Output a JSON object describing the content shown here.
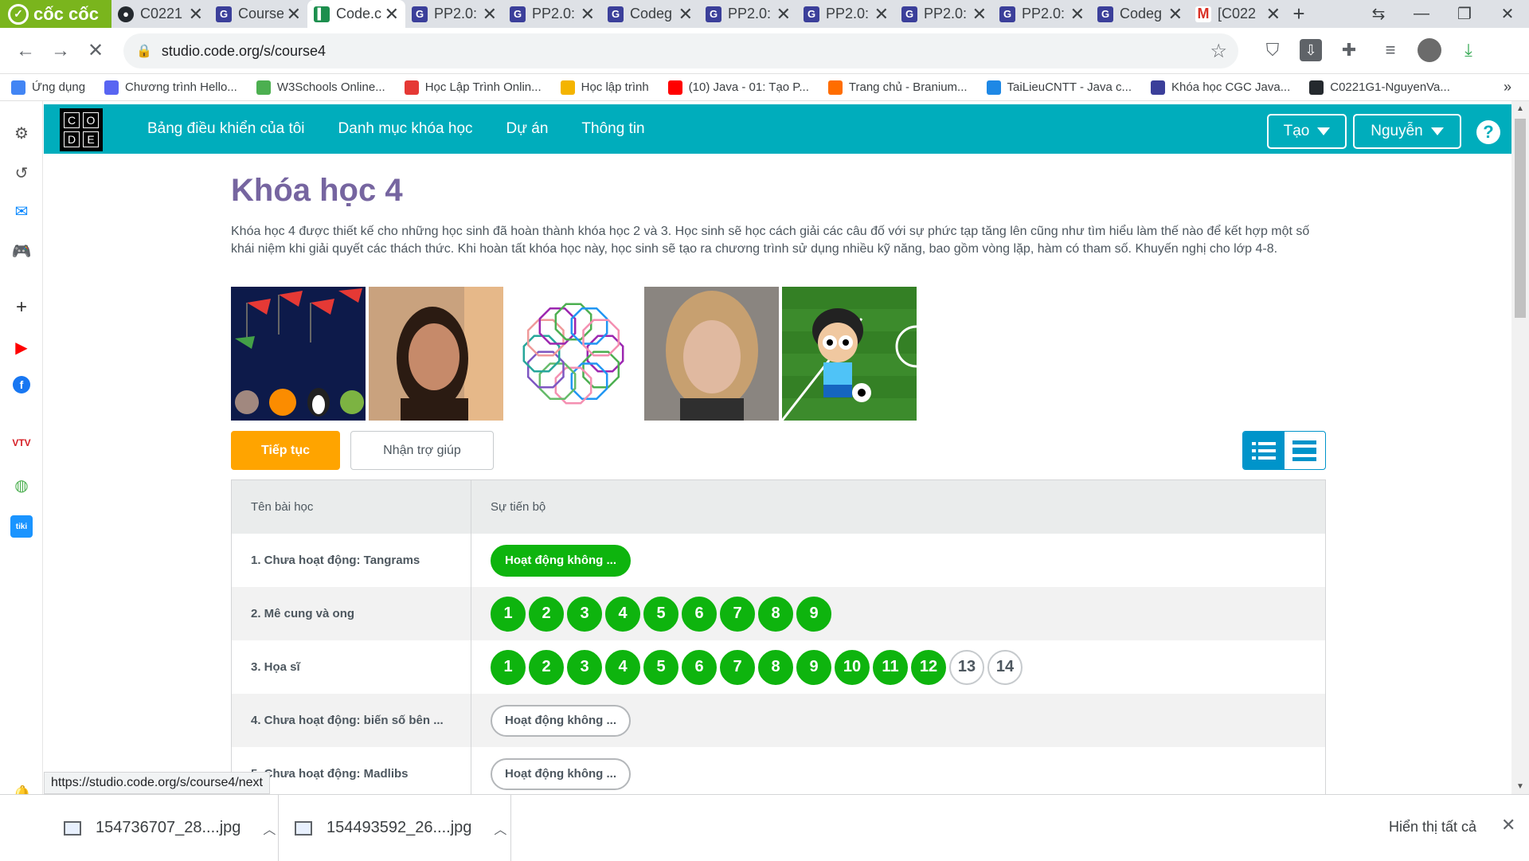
{
  "browser": {
    "brand": "cốc cốc",
    "tabs": [
      {
        "title": "C0221",
        "icon": "github-icon"
      },
      {
        "title": "Course",
        "icon": "codegym-icon"
      },
      {
        "title": "Code.c",
        "icon": "code-org-icon",
        "active": true
      },
      {
        "title": "PP2.0:",
        "icon": "codegym-icon"
      },
      {
        "title": "PP2.0:",
        "icon": "codegym-icon"
      },
      {
        "title": "Codeg",
        "icon": "codegym-icon"
      },
      {
        "title": "PP2.0:",
        "icon": "codegym-icon"
      },
      {
        "title": "PP2.0:",
        "icon": "codegym-icon"
      },
      {
        "title": "PP2.0:",
        "icon": "codegym-icon"
      },
      {
        "title": "PP2.0:",
        "icon": "codegym-icon"
      },
      {
        "title": "Codeg",
        "icon": "codegym-icon"
      },
      {
        "title": "[C022",
        "icon": "gmail-icon"
      }
    ],
    "url": "studio.code.org/s/course4",
    "bookmarks": [
      {
        "label": "Ứng dụng",
        "color": "#4285f4"
      },
      {
        "label": "Chương trình Hello...",
        "color": "#5865f2"
      },
      {
        "label": "W3Schools Online...",
        "color": "#4caf50"
      },
      {
        "label": "Học Lập Trình Onlin...",
        "color": "#e53935"
      },
      {
        "label": "Học lập trình",
        "color": "#f4b400"
      },
      {
        "label": "(10) Java - 01: Tạo P...",
        "color": "#ff0000"
      },
      {
        "label": "Trang chủ - Branium...",
        "color": "#ff6d00"
      },
      {
        "label": "TaiLieuCNTT - Java c...",
        "color": "#1e88e5"
      },
      {
        "label": "Khóa học CGC Java...",
        "color": "#3b3f9a"
      },
      {
        "label": "C0221G1-NguyenVa...",
        "color": "#24292e"
      }
    ],
    "status_url": "https://studio.code.org/s/course4/next"
  },
  "site": {
    "logo_letters": [
      "C",
      "O",
      "D",
      "E"
    ],
    "nav": [
      "Bảng điều khiển của tôi",
      "Danh mục khóa học",
      "Dự án",
      "Thông tin"
    ],
    "create_label": "Tạo",
    "user_label": "Nguyễn",
    "help_label": "?"
  },
  "course": {
    "title": "Khóa học 4",
    "description": "Khóa học 4 được thiết kế cho những học sinh đã hoàn thành khóa học 2 và 3. Học sinh sẽ học cách giải các câu đố với sự phức tạp tăng lên cũng như tìm hiểu làm thế nào để kết hợp một số khái niệm khi giải quyết các thách thức. Khi hoàn tất khóa học này, học sinh sẽ tạo ra chương trình sử dụng nhiều kỹ năng, bao gồm vòng lặp, hàm có tham số. Khuyến nghị cho lớp 4-8.",
    "continue_label": "Tiếp tục",
    "help_label": "Nhận trợ giúp"
  },
  "table": {
    "col_lesson": "Tên bài học",
    "col_progress": "Sự tiến bộ",
    "rows": [
      {
        "name": "1. Chưa hoạt động: Tangrams",
        "type": "pill",
        "pill": "Hoạt động không ...",
        "done": true
      },
      {
        "name": "2. Mê cung và ong",
        "type": "bubbles",
        "levels": [
          "1",
          "2",
          "3",
          "4",
          "5",
          "6",
          "7",
          "8",
          "9"
        ],
        "completed": 9
      },
      {
        "name": "3. Họa sĩ",
        "type": "bubbles",
        "levels": [
          "1",
          "2",
          "3",
          "4",
          "5",
          "6",
          "7",
          "8",
          "9",
          "10",
          "11",
          "12",
          "13",
          "14"
        ],
        "completed": 12
      },
      {
        "name": "4. Chưa hoạt động: biến số bên ...",
        "type": "pill",
        "pill": "Hoạt động không ...",
        "done": false
      },
      {
        "name": "5. Chưa hoạt động: Madlibs",
        "type": "pill",
        "pill": "Hoạt động không ...",
        "done": false
      }
    ]
  },
  "downloads": {
    "items": [
      "154736707_28....jpg",
      "154493592_26....jpg"
    ],
    "show_all": "Hiển thị tất cả"
  },
  "colors": {
    "header": "#00adbc",
    "title": "#7665a0",
    "continue": "#ffa400",
    "done": "#0eb40e"
  }
}
